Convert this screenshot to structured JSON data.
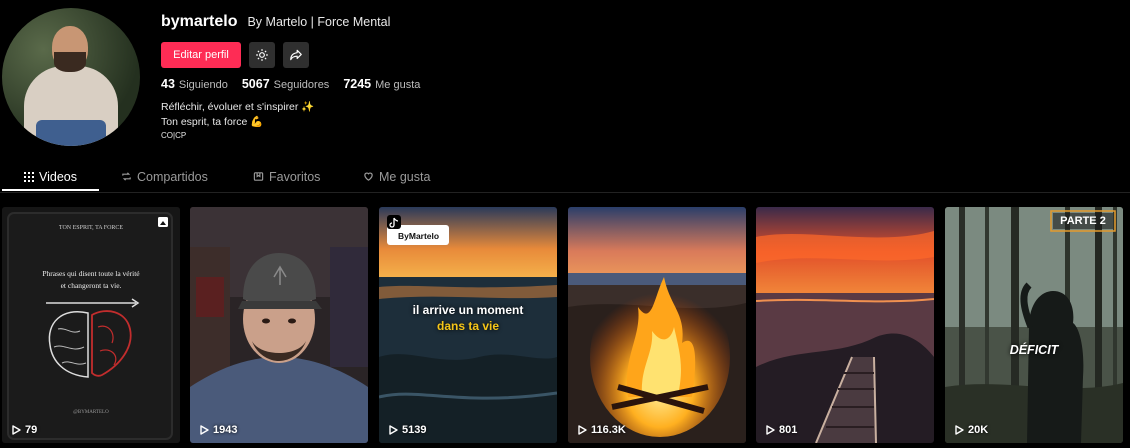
{
  "profile": {
    "username": "bymartelo",
    "nickname": "By Martelo | Force Mental",
    "edit_label": "Editar perfil",
    "stats": [
      {
        "num": "43",
        "label": "Siguiendo"
      },
      {
        "num": "5067",
        "label": "Seguidores"
      },
      {
        "num": "7245",
        "label": "Me gusta"
      }
    ],
    "bio": {
      "line1": "Réfléchir, évoluer et s'inspirer ✨",
      "line2": "Ton esprit, ta force 💪",
      "line3": "CO|CP"
    }
  },
  "tabs": [
    "Videos",
    "Compartidos",
    "Favoritos",
    "Me gusta"
  ],
  "videos": [
    {
      "plays": "79",
      "book_header": "TON ESPRIT, TA FORCE",
      "book_text1": "Phrases qui disent toute la vérité",
      "book_text2": "et changeront ta vie.",
      "book_footer": "@BYMARTELO"
    },
    {
      "plays": "1943"
    },
    {
      "plays": "5139",
      "watermark": "ByMartelo",
      "caption1": "il arrive un moment",
      "caption2": "dans ta vie"
    },
    {
      "plays": "116.3K"
    },
    {
      "plays": "801"
    },
    {
      "plays": "20K",
      "badge": "PARTE 2",
      "caption": "DÉFICIT"
    }
  ],
  "colors": {
    "accent": "#fe2c55",
    "background": "#000000",
    "badge": "#e59b2d"
  }
}
